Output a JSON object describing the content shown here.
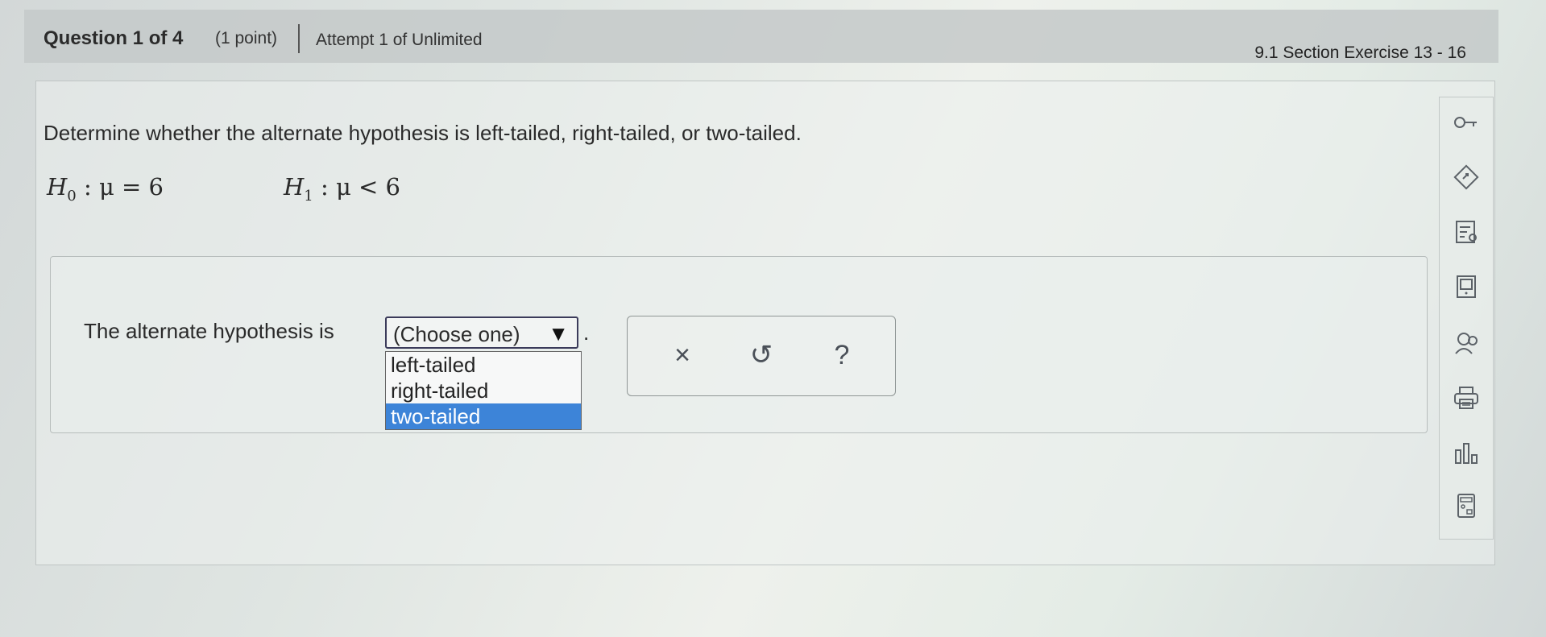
{
  "header": {
    "question_label": "Question 1 of 4",
    "points": "(1 point)",
    "attempt": "Attempt 1 of Unlimited",
    "section": "9.1 Section Exercise 13 - 16"
  },
  "question": {
    "prompt": "Determine whether the alternate hypothesis is left-tailed, right-tailed, or two-tailed.",
    "h0_symbol": "H",
    "h0_sub": "0",
    "h0_rest": " : μ = 6",
    "h1_symbol": "H",
    "h1_sub": "1",
    "h1_rest": " : μ < 6"
  },
  "answer": {
    "label": "The alternate hypothesis is",
    "select_value": "(Choose one)",
    "select_arrow": "▼",
    "period": ".",
    "options": [
      "left-tailed",
      "right-tailed",
      "two-tailed"
    ],
    "highlighted_option": "two-tailed"
  },
  "tools": {
    "clear_icon": "×",
    "undo_icon": "↺",
    "help_icon": "?"
  },
  "sidebar": {
    "icons": [
      "key-icon",
      "hint-icon",
      "notes-icon",
      "textbook-icon",
      "ask-help-icon",
      "print-icon",
      "grades-icon",
      "calculator-icon"
    ]
  },
  "colors": {
    "highlight": "#3d84d8",
    "header_bg": "#c4c9c9"
  }
}
